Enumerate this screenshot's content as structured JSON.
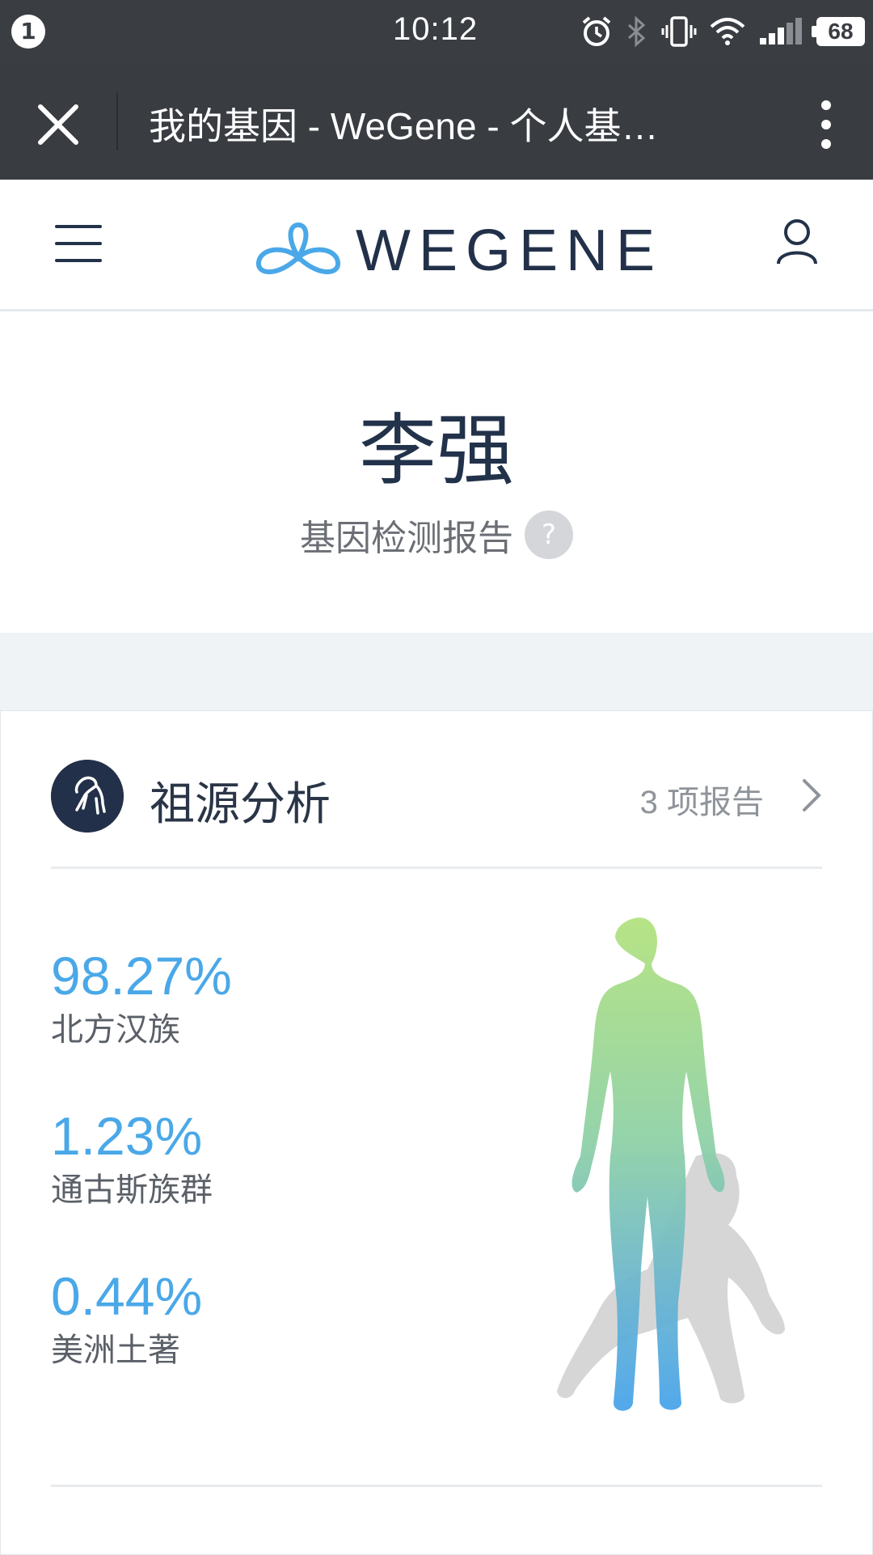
{
  "status_bar": {
    "notification_count": "1",
    "time": "10:12",
    "battery": "68",
    "icons": [
      "alarm-icon",
      "bluetooth-icon",
      "vibrate-icon",
      "wifi-icon",
      "signal-icon",
      "battery-icon"
    ]
  },
  "browser": {
    "title": "我的基因 - WeGene - 个人基…"
  },
  "header": {
    "logo_text": "WEGENE"
  },
  "profile": {
    "name": "李强",
    "subtitle": "基因检测报告",
    "help": "?"
  },
  "ancestry_card": {
    "title": "祖源分析",
    "report_count": "3 项报告",
    "items": [
      {
        "percent": "98.27%",
        "name": "北方汉族"
      },
      {
        "percent": "1.23%",
        "name": "通古斯族群"
      },
      {
        "percent": "0.44%",
        "name": "美洲土著"
      }
    ]
  },
  "colors": {
    "status_bar": "#3a3d42",
    "browser_bar": "#393c41",
    "brand_dark": "#223149",
    "accent_blue": "#4aa8e8",
    "gap_bg": "#eff3f6"
  }
}
